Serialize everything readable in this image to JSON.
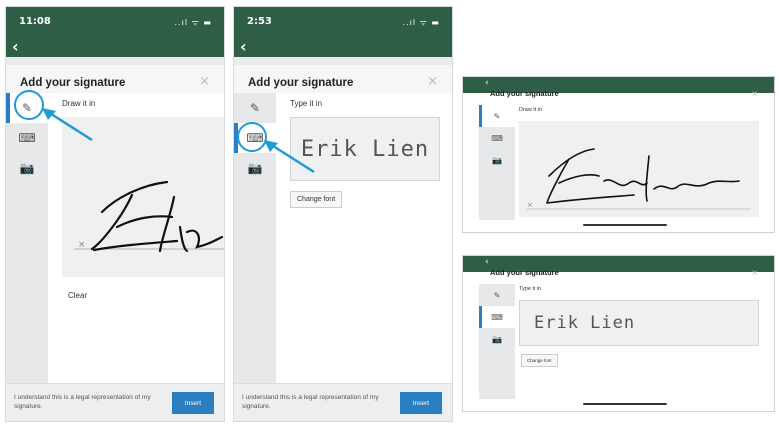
{
  "phones": [
    {
      "status_time": "11:08",
      "status_icons": "..ıl ᯤ ▬",
      "back_glyph": "‹",
      "title": "Add your signature",
      "close_glyph": "×",
      "tabs": [
        {
          "icon": "pencil-icon",
          "glyph": "✎",
          "active": true
        },
        {
          "icon": "keyboard-icon",
          "glyph": "⌨",
          "active": false
        },
        {
          "icon": "camera-icon",
          "glyph": "📷",
          "active": false
        }
      ],
      "subtitle": "Draw it in",
      "clear_label": "Clear",
      "legal_text": "I understand this is a legal representation of my signature.",
      "insert_label": "Insert"
    },
    {
      "status_time": "2:53",
      "status_icons": "..ıl ᯤ ▬",
      "back_glyph": "‹",
      "title": "Add your signature",
      "close_glyph": "×",
      "tabs": [
        {
          "icon": "pencil-icon",
          "glyph": "✎",
          "active": false
        },
        {
          "icon": "keyboard-icon",
          "glyph": "⌨",
          "active": true
        },
        {
          "icon": "camera-icon",
          "glyph": "📷",
          "active": false
        }
      ],
      "subtitle": "Type it in",
      "typed_name": "Erik Lien",
      "change_font_label": "Change font",
      "legal_text": "I understand this is a legal representation of my signature.",
      "insert_label": "Insert"
    }
  ],
  "tablets": [
    {
      "back_glyph": "‹",
      "title": "Add your signature",
      "close_glyph": "×",
      "subtitle": "Draw it in",
      "tabs": [
        {
          "icon": "pencil-icon",
          "glyph": "✎",
          "active": true
        },
        {
          "icon": "keyboard-icon",
          "glyph": "⌨",
          "active": false
        },
        {
          "icon": "camera-icon",
          "glyph": "📷",
          "active": false
        }
      ]
    },
    {
      "back_glyph": "‹",
      "title": "Add your signature",
      "close_glyph": "×",
      "subtitle": "Type it in",
      "typed_name": "Erik Lien",
      "change_font_label": "Change font",
      "tabs": [
        {
          "icon": "pencil-icon",
          "glyph": "✎",
          "active": false
        },
        {
          "icon": "keyboard-icon",
          "glyph": "⌨",
          "active": true
        },
        {
          "icon": "camera-icon",
          "glyph": "📷",
          "active": false
        }
      ]
    }
  ],
  "colors": {
    "header_green": "#2f5e46",
    "accent_blue": "#2a7fc2",
    "callout_blue": "#1f9bd6"
  }
}
